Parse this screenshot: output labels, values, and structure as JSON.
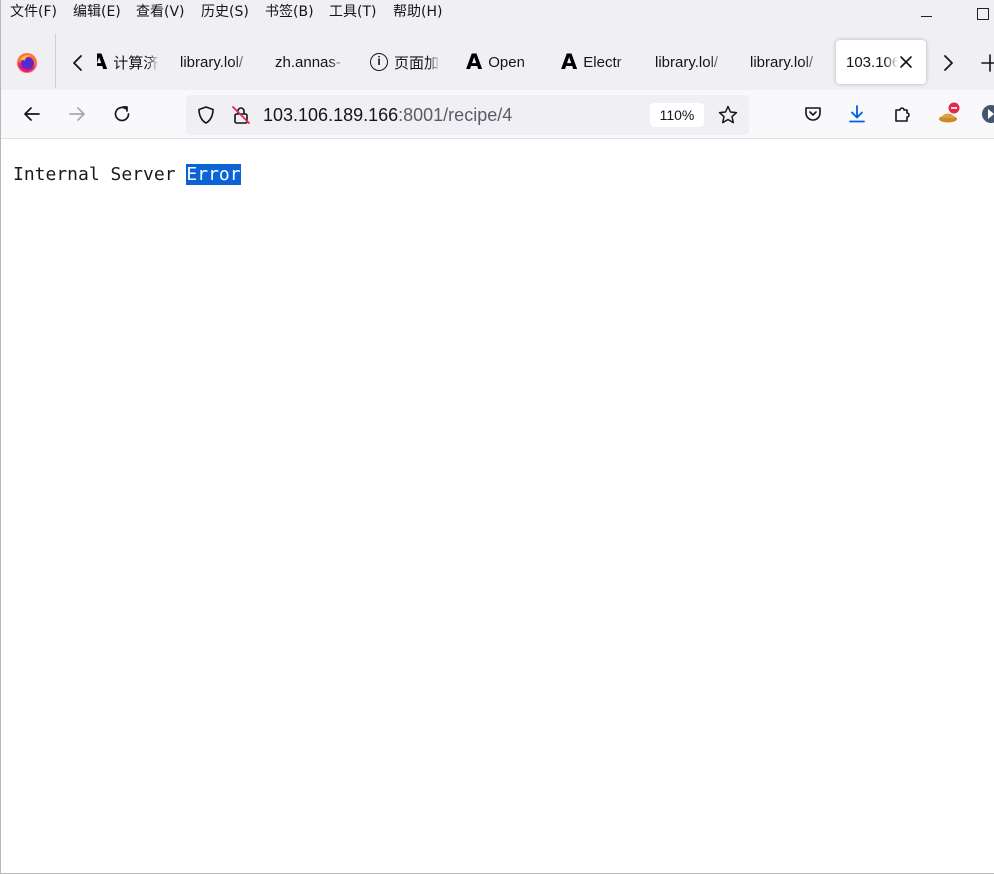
{
  "menubar": {
    "items": [
      "文件(F)",
      "编辑(E)",
      "查看(V)",
      "历史(S)",
      "书签(B)",
      "工具(T)",
      "帮助(H)"
    ]
  },
  "tabs": [
    {
      "label": "计算济",
      "icon": "a-logo-icon"
    },
    {
      "label": "library.lol/",
      "icon": "none"
    },
    {
      "label": "zh.annas-",
      "icon": "none"
    },
    {
      "label": "页面加",
      "icon": "info-circle-icon"
    },
    {
      "label": "Open",
      "icon": "a-logo-icon"
    },
    {
      "label": "Electr",
      "icon": "a-logo-icon"
    },
    {
      "label": "library.lol/",
      "icon": "none"
    },
    {
      "label": "library.lol/",
      "icon": "none"
    },
    {
      "label": "103.106",
      "icon": "none",
      "active": true
    }
  ],
  "tab_icon_glyphs": {
    "a_logo": "A",
    "info": "i"
  },
  "navbar": {
    "url_host": "103.106.189.166",
    "url_rest": ":8001/recipe/4",
    "zoom": "110%"
  },
  "content": {
    "text_prefix": "Internal Server ",
    "text_selected": "Error"
  },
  "colors": {
    "selection": "#0a64d6",
    "chrome_bg": "#f0f0f4",
    "download_accent": "#0060df"
  }
}
